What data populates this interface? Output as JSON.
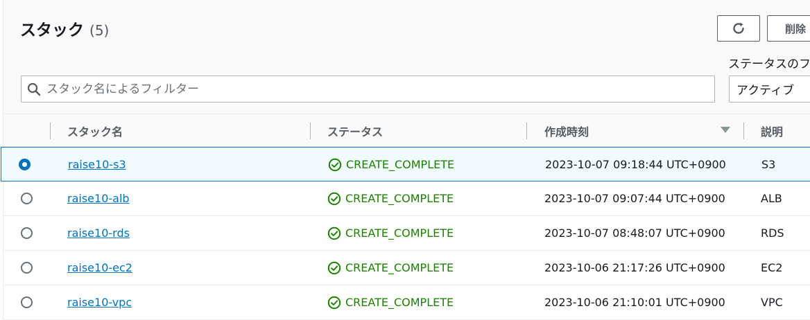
{
  "header": {
    "title": "スタック",
    "count": "(5)",
    "refresh_icon": "refresh-icon",
    "delete_label": "削除"
  },
  "filter": {
    "search_placeholder": "スタック名によるフィルター",
    "search_value": "",
    "status_label": "ステータスのフ",
    "status_value": "アクティブ"
  },
  "table": {
    "columns": [
      "スタック名",
      "ステータス",
      "作成時刻",
      "説明"
    ],
    "sort_column": "作成時刻",
    "sort_direction": "descending",
    "rows": [
      {
        "name": "raise10-s3",
        "status": "CREATE_COMPLETE",
        "created": "2023-10-07 09:18:44 UTC+0900",
        "description": "S3",
        "selected": true
      },
      {
        "name": "raise10-alb",
        "status": "CREATE_COMPLETE",
        "created": "2023-10-07 09:07:44 UTC+0900",
        "description": "ALB",
        "selected": false
      },
      {
        "name": "raise10-rds",
        "status": "CREATE_COMPLETE",
        "created": "2023-10-07 08:48:07 UTC+0900",
        "description": "RDS",
        "selected": false
      },
      {
        "name": "raise10-ec2",
        "status": "CREATE_COMPLETE",
        "created": "2023-10-06 21:17:26 UTC+0900",
        "description": "EC2",
        "selected": false
      },
      {
        "name": "raise10-vpc",
        "status": "CREATE_COMPLETE",
        "created": "2023-10-06 21:10:01 UTC+0900",
        "description": "VPC",
        "selected": false
      }
    ]
  },
  "colors": {
    "link": "#0073bb",
    "success": "#1d8102",
    "selected_border": "#0073bb",
    "selected_bg": "#f1faff"
  }
}
